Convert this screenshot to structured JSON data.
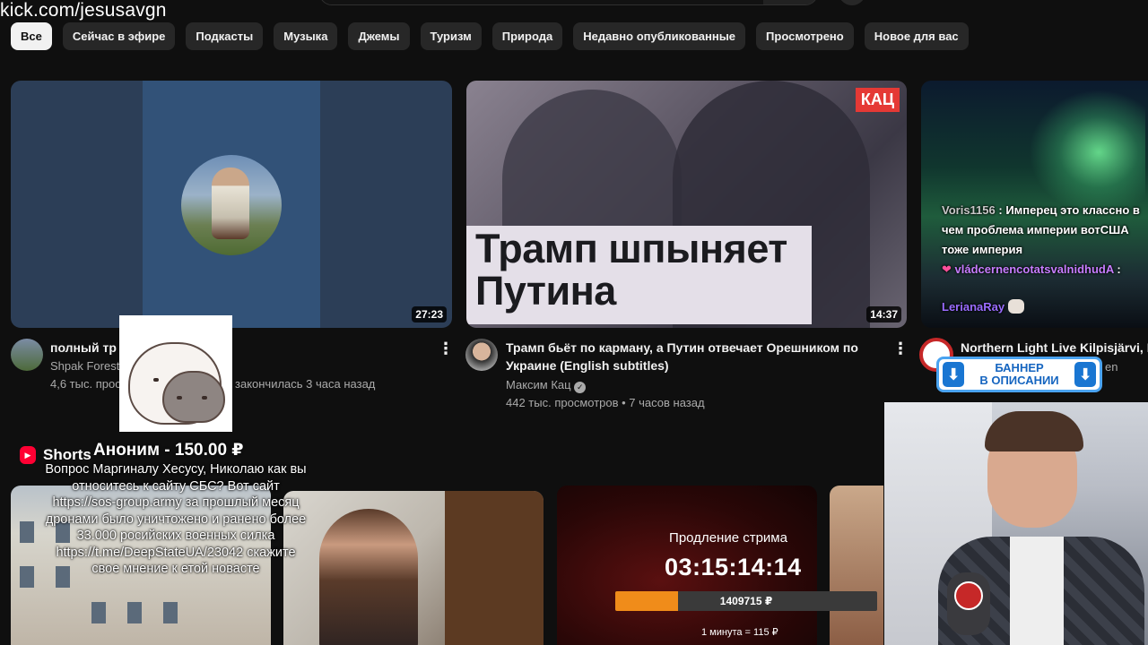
{
  "overlay": {
    "url": "kick.com/jesusavgn"
  },
  "chips": [
    "Все",
    "Сейчас в эфире",
    "Подкасты",
    "Музыка",
    "Джемы",
    "Туризм",
    "Природа",
    "Недавно опубликованные",
    "Просмотрено",
    "Новое для вас"
  ],
  "videos": [
    {
      "title": "полный тр",
      "channel": "Shpak Forest",
      "meta": "4,6 тыс. прос",
      "meta2": "закончилась 3 часа назад",
      "duration": "27:23"
    },
    {
      "title": "Трамп бьёт по карману, а Путин отвечает Орешником по Украине (English subtitles)",
      "channel": "Максим Кац",
      "meta": "442 тыс. просмотров • 7 часов назад",
      "duration": "14:37",
      "thumb_text": "Трамп шпыняет Путина",
      "badge": "КАЦ"
    },
    {
      "title": "Northern Light Live Kilpisjärvi, F",
      "meta_tail": "en"
    }
  ],
  "chat": [
    {
      "user": "Voris1156",
      "text": ": Имперец это классно в чем проблема империи вотСША тоже империя"
    },
    {
      "user": "vládcernencotatsvalnidhudA",
      "text": ":"
    },
    {
      "user": "LerianaRay",
      "text": ""
    }
  ],
  "banner": {
    "line1": "БАННЕР",
    "line2": "В ОПИСАНИИ"
  },
  "shorts": {
    "label": "Shorts"
  },
  "donation": {
    "donor": "Аноним - 150.00 ₽",
    "message": "Вопрос Маргиналу Хесусу, Николаю как вы относитесь к сайту СБС? Вот сайт https://sos-group.army за прошлый месяц дронами было уничтожено и ранено более 33.000 росийских военных силка https://t.me/DeepStateUA/23042 скажите свое мнение к етой новасте"
  },
  "stream_extend": {
    "label": "Продление стрима",
    "timer": "03:15:14:14",
    "amount": "1409715 ₽",
    "progress": 0.24,
    "rate": "1 минута = 115 ₽"
  },
  "colors": {
    "bg": "#0f0f0f",
    "chip": "#272727",
    "progress": "#f08c1a",
    "banner_border": "#4aa3f0"
  },
  "icons": [
    "more-vert-icon",
    "verified-icon",
    "shorts-icon",
    "arrow-down-icon"
  ]
}
